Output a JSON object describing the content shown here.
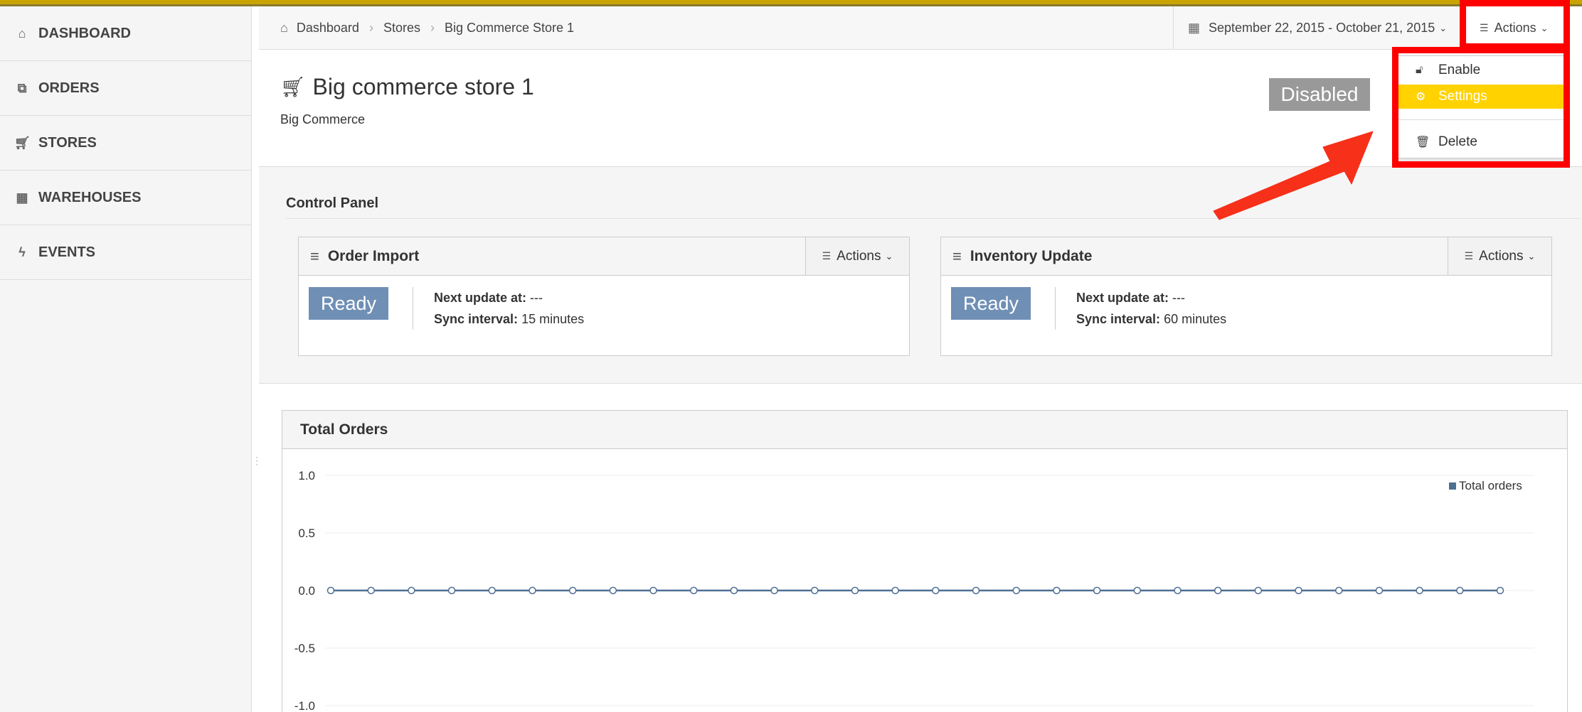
{
  "sidebar": {
    "items": [
      {
        "label": "DASHBOARD",
        "icon": "home-icon",
        "glyph": "⌂"
      },
      {
        "label": "ORDERS",
        "icon": "copy-icon",
        "glyph": "⧉"
      },
      {
        "label": "STORES",
        "icon": "cart-icon",
        "glyph": "🛒︎"
      },
      {
        "label": "WAREHOUSES",
        "icon": "building-icon",
        "glyph": "▦"
      },
      {
        "label": "EVENTS",
        "icon": "bolt-icon",
        "glyph": "ϟ"
      }
    ]
  },
  "header": {
    "breadcrumb": [
      "Dashboard",
      "Stores",
      "Big Commerce Store 1"
    ],
    "date_range": "September 22, 2015 - October 21, 2015",
    "actions_label": "Actions"
  },
  "store": {
    "title": "Big commerce store 1",
    "subtitle": "Big Commerce",
    "status": "Disabled",
    "status_color": "#999999"
  },
  "actions_menu": {
    "items": [
      {
        "label": "Enable",
        "icon": "unlock-icon"
      },
      {
        "label": "Settings",
        "icon": "cogs-icon",
        "active": true
      },
      {
        "label": "Delete",
        "icon": "trash-icon"
      }
    ],
    "highlight_color": "#ffd200"
  },
  "control_panel": {
    "title": "Control Panel",
    "panels": [
      {
        "title": "Order Import",
        "actions_label": "Actions",
        "status": "Ready",
        "next_update_label": "Next update at:",
        "next_update_value": "---",
        "sync_interval_label": "Sync interval:",
        "sync_interval_value": "15 minutes"
      },
      {
        "title": "Inventory Update",
        "actions_label": "Actions",
        "status": "Ready",
        "next_update_label": "Next update at:",
        "next_update_value": "---",
        "sync_interval_label": "Sync interval:",
        "sync_interval_value": "60 minutes"
      }
    ]
  },
  "total_orders": {
    "title": "Total Orders"
  },
  "chart_data": {
    "type": "line",
    "title": "Total Orders",
    "xlabel": "",
    "ylabel": "",
    "ylim": [
      -1.0,
      1.0
    ],
    "yticks": [
      "1.0",
      "0.5",
      "0.0",
      "-0.5",
      "-1.0"
    ],
    "grid": true,
    "legend_position": "top-right",
    "series": [
      {
        "name": "Total orders",
        "color": "#4e6f93",
        "values": [
          0,
          0,
          0,
          0,
          0,
          0,
          0,
          0,
          0,
          0,
          0,
          0,
          0,
          0,
          0,
          0,
          0,
          0,
          0,
          0,
          0,
          0,
          0,
          0,
          0,
          0,
          0,
          0,
          0,
          0
        ]
      }
    ]
  }
}
